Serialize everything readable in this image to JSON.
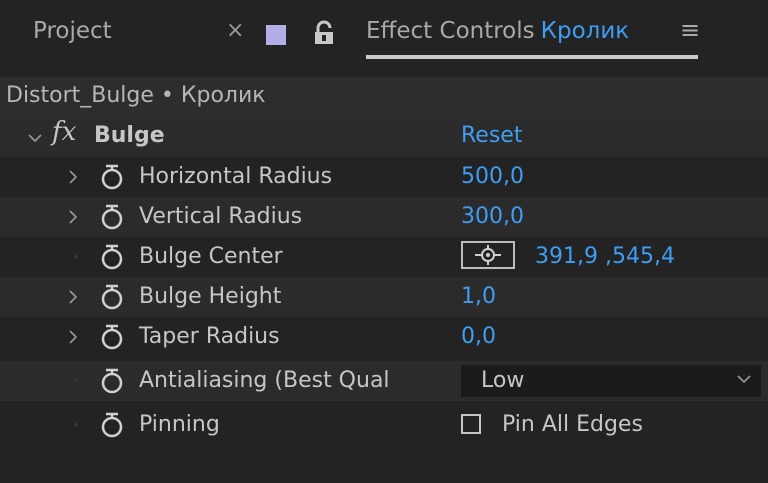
{
  "tabs": {
    "project": "Project",
    "close": "×",
    "effect_controls": "Effect Controls",
    "layer_name": "Кролик",
    "menu": "≡"
  },
  "breadcrumb": "Distort_Bulge • Кролик",
  "effect": {
    "fx_symbol": "fx",
    "name": "Bulge",
    "reset": "Reset"
  },
  "properties": [
    {
      "label": "Horizontal Radius",
      "value": "500,0"
    },
    {
      "label": "Vertical Radius",
      "value": "300,0"
    },
    {
      "label": "Bulge Center",
      "value": "391,9 ,545,4"
    },
    {
      "label": "Bulge Height",
      "value": "1,0"
    },
    {
      "label": "Taper Radius",
      "value": "0,0"
    },
    {
      "label": "Antialiasing (Best Qual",
      "value": "Low"
    },
    {
      "label": "Pinning",
      "value": "Pin All Edges"
    }
  ],
  "colors": {
    "accent": "#3f9df2",
    "swatch": "#b3aee8",
    "background": "#232323"
  }
}
